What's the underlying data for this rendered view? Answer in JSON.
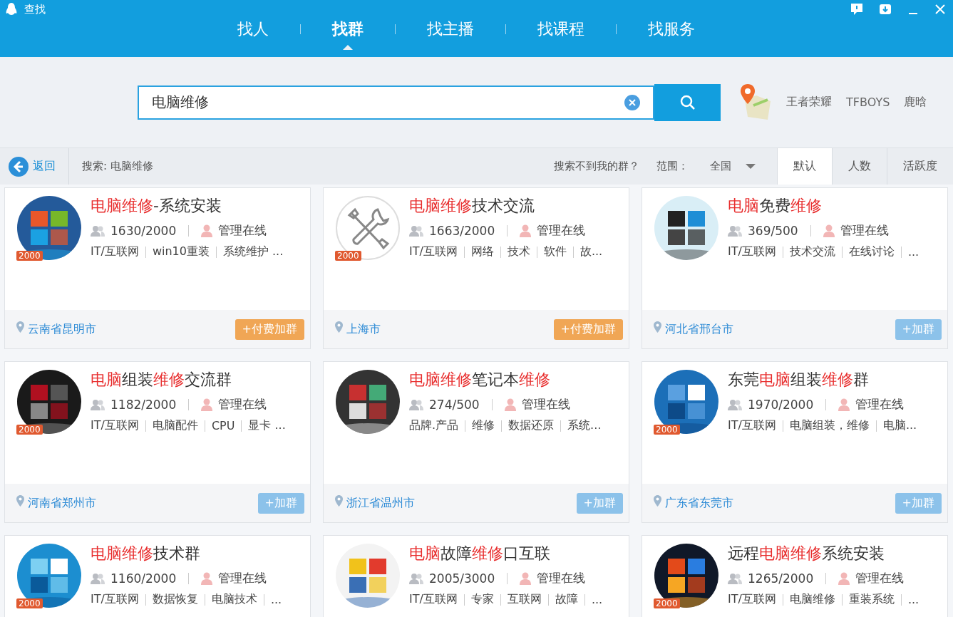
{
  "window": {
    "title": "查找"
  },
  "nav": [
    {
      "label": "找人",
      "selected": false
    },
    {
      "label": "找群",
      "selected": true
    },
    {
      "label": "找主播",
      "selected": false
    },
    {
      "label": "找课程",
      "selected": false
    },
    {
      "label": "找服务",
      "selected": false
    }
  ],
  "search": {
    "value": "电脑维修"
  },
  "hot_words": [
    "王者荣耀",
    "TFBOYS",
    "鹿晗"
  ],
  "filter_bar": {
    "back": "返回",
    "query": "搜索: 电脑维修",
    "help": "搜索不到我的群？",
    "scope_label": "范围：",
    "scope": "全国",
    "sort": [
      {
        "label": "默认",
        "selected": true
      },
      {
        "label": "人数",
        "selected": false
      },
      {
        "label": "活跃度",
        "selected": false
      }
    ]
  },
  "groups": [
    {
      "title": [
        {
          "text": "电脑维修",
          "highlight": true
        },
        {
          "text": "-系统安装",
          "highlight": false
        }
      ],
      "avatar": {
        "kind": "picture"
      },
      "badge": "2000",
      "members": "1630/2000",
      "admin": "管理在线",
      "tags": [
        "IT/互联网",
        "win10重装",
        "系统维护 ..."
      ],
      "location": "云南省昆明市",
      "button": {
        "kind": "paid",
        "label": "+付费加群"
      }
    },
    {
      "title": [
        {
          "text": "电脑维修",
          "highlight": true
        },
        {
          "text": "技术交流",
          "highlight": false
        }
      ],
      "avatar": {
        "kind": "icon"
      },
      "badge": "2000",
      "members": "1663/2000",
      "admin": "管理在线",
      "tags": [
        "IT/互联网",
        "网络",
        "技术",
        "软件",
        "故..."
      ],
      "location": "上海市",
      "button": {
        "kind": "paid",
        "label": "+付费加群"
      }
    },
    {
      "title": [
        {
          "text": "电脑",
          "highlight": true
        },
        {
          "text": "免费",
          "highlight": false
        },
        {
          "text": "维修",
          "highlight": true
        }
      ],
      "avatar": {
        "kind": "picture"
      },
      "members": "369/500",
      "admin": "管理在线",
      "tags": [
        "IT/互联网",
        "技术交流",
        "在线讨论",
        "..."
      ],
      "location": "河北省邢台市",
      "button": {
        "kind": "free",
        "label": "+加群"
      }
    },
    {
      "title": [
        {
          "text": "电脑",
          "highlight": true
        },
        {
          "text": "组装",
          "highlight": false
        },
        {
          "text": "维修",
          "highlight": true
        },
        {
          "text": "交流群",
          "highlight": false
        }
      ],
      "avatar": {
        "kind": "picture"
      },
      "badge": "2000",
      "members": "1182/2000",
      "admin": "管理在线",
      "tags": [
        "IT/互联网",
        "电脑配件",
        "CPU",
        "显卡 ..."
      ],
      "location": "河南省郑州市",
      "button": {
        "kind": "free",
        "label": "+加群"
      }
    },
    {
      "title": [
        {
          "text": "电脑维修",
          "highlight": true
        },
        {
          "text": "笔记本",
          "highlight": false
        },
        {
          "text": "维修",
          "highlight": true
        }
      ],
      "avatar": {
        "kind": "picture"
      },
      "members": "274/500",
      "admin": "管理在线",
      "tags": [
        "品牌.产品",
        "维修",
        "数据还原",
        "系统..."
      ],
      "location": "浙江省温州市",
      "button": {
        "kind": "free",
        "label": "+加群"
      }
    },
    {
      "title": [
        {
          "text": "东莞",
          "highlight": false
        },
        {
          "text": "电脑",
          "highlight": true
        },
        {
          "text": "组装",
          "highlight": false
        },
        {
          "text": "维修",
          "highlight": true
        },
        {
          "text": "群",
          "highlight": false
        }
      ],
      "avatar": {
        "kind": "picture"
      },
      "badge": "2000",
      "members": "1970/2000",
      "admin": "管理在线",
      "tags": [
        "IT/互联网",
        "电脑组装，维修",
        "电脑..."
      ],
      "location": "广东省东莞市",
      "button": {
        "kind": "free",
        "label": "+加群"
      }
    },
    {
      "title": [
        {
          "text": "电脑维修",
          "highlight": true
        },
        {
          "text": "技术群",
          "highlight": false
        }
      ],
      "avatar": {
        "kind": "picture"
      },
      "badge": "2000",
      "members": "1160/2000",
      "admin": "管理在线",
      "tags": [
        "IT/互联网",
        "数据恢复",
        "电脑技术",
        "..."
      ]
    },
    {
      "title": [
        {
          "text": "电脑",
          "highlight": true
        },
        {
          "text": "故障",
          "highlight": false
        },
        {
          "text": "维修",
          "highlight": true
        },
        {
          "text": "口互联",
          "highlight": false
        }
      ],
      "avatar": {
        "kind": "picture"
      },
      "members": "2005/3000",
      "admin": "管理在线",
      "tags": [
        "IT/互联网",
        "专家",
        "互联网",
        "故障",
        "..."
      ]
    },
    {
      "title": [
        {
          "text": "远程",
          "highlight": false
        },
        {
          "text": "电脑维修",
          "highlight": true
        },
        {
          "text": "系统安装",
          "highlight": false
        }
      ],
      "avatar": {
        "kind": "picture"
      },
      "badge": "2000",
      "members": "1265/2000",
      "admin": "管理在线",
      "tags": [
        "IT/互联网",
        "电脑维修",
        "重装系统",
        "..."
      ]
    }
  ]
}
